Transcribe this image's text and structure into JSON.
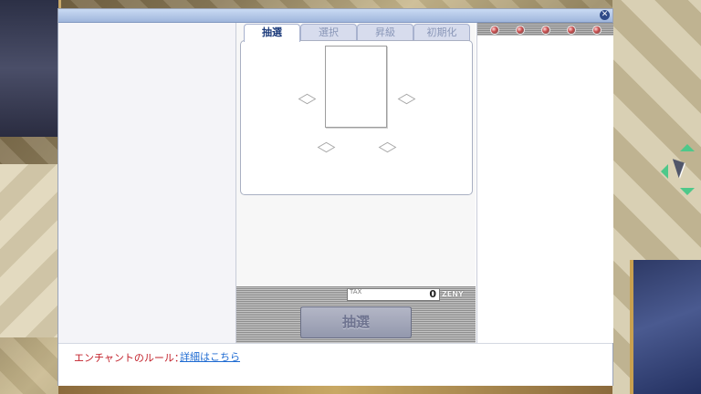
{
  "window": {
    "close_icon": "close-icon"
  },
  "tabs": [
    {
      "label": "抽選",
      "active": true
    },
    {
      "label": "選択",
      "active": false
    },
    {
      "label": "昇級",
      "active": false
    },
    {
      "label": "初期化",
      "active": false
    }
  ],
  "enchant_slots": {
    "count": 4,
    "icon": "diamond-slot-icon"
  },
  "right_slot_indicators": {
    "count": 5,
    "icon": "slot-dot-icon"
  },
  "tax": {
    "label": "TAX",
    "value": "0",
    "currency": "ZENY"
  },
  "action_button": {
    "label": "抽選"
  },
  "footer": {
    "rule_label": "エンチャントのルール：",
    "rule_link": "詳細はこちら"
  },
  "colors": {
    "title_bar": "#9fb6dc",
    "active_tab_text": "#1b3a7a",
    "rule_text": "#c2202a",
    "link": "#1f6bd2"
  }
}
